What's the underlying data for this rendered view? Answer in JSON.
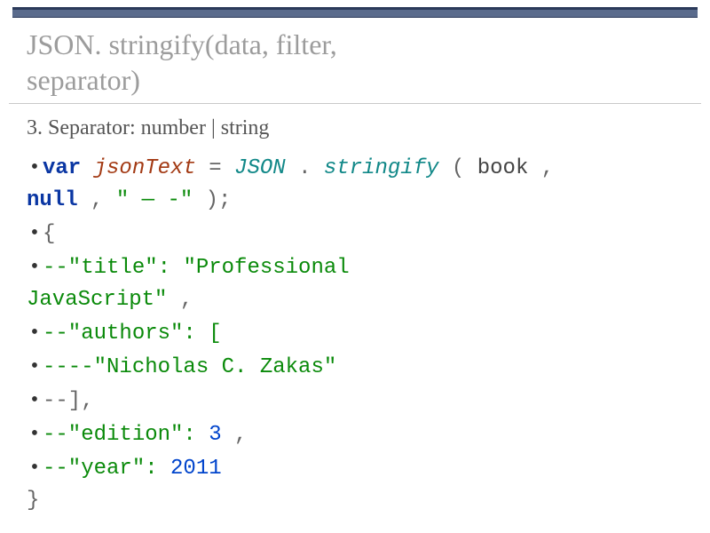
{
  "title_line1": "JSON. stringify(data, filter,",
  "title_line2": "separator)",
  "subhead": "3. Separator: number | string",
  "code": {
    "kw_var": "var",
    "ident": "jsonText",
    "eq": " = ",
    "type_json": "JSON",
    "dot": ".",
    "fn_stringify": "stringify",
    "lparen": "(",
    "arg_book": "book",
    "comma1": ",",
    "arg_null": "null",
    "comma2": ",",
    "sep_string": "\" — -\"",
    "rparen_semi": ");",
    "line_open": "{",
    "l_title_key": "--\"title\": ",
    "l_title_val": "\"Professional",
    "l_title_val2": "JavaScript\"",
    "l_title_trail": ",",
    "l_authors": "--\"authors\": [",
    "l_author_name": "----\"Nicholas C. Zakas\"",
    "l_authors_close": "--],",
    "l_edition_key": "--\"edition\": ",
    "l_edition_val": "3",
    "l_edition_trail": ",",
    "l_year_key": "--\"year\": ",
    "l_year_val": "2011",
    "line_close": "}"
  }
}
